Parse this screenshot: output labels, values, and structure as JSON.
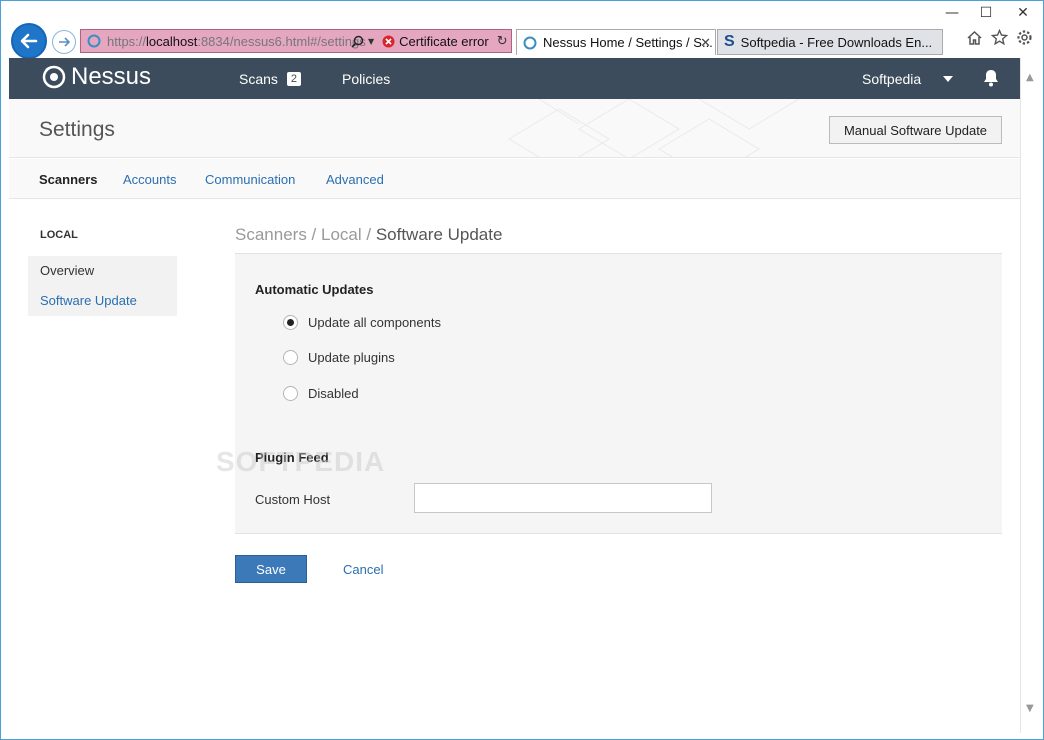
{
  "browser": {
    "url_prefix": "https://",
    "url_host": "localhost",
    "url_rest": ":8834/nessus6.html#/settings",
    "cert_error": "Certificate error",
    "tabs": [
      {
        "title": "Nessus Home / Settings / S...",
        "close": "✕"
      },
      {
        "title": "Softpedia - Free Downloads En..."
      }
    ],
    "window_controls": {
      "minimize": "—",
      "maximize": "☐",
      "close": "✕"
    }
  },
  "header": {
    "logo": "Nessus",
    "scans_label": "Scans",
    "scans_count": "2",
    "policies_label": "Policies",
    "user": "Softpedia"
  },
  "page": {
    "title": "Settings",
    "manual_update": "Manual Software Update",
    "tabs": [
      "Scanners",
      "Accounts",
      "Communication",
      "Advanced"
    ]
  },
  "sidebar": {
    "heading": "LOCAL",
    "items": [
      "Overview",
      "Software Update"
    ]
  },
  "breadcrumb": {
    "part1": "Scanners",
    "sep": " / ",
    "part2": "Local",
    "current": "Software Update"
  },
  "form": {
    "auto_updates_title": "Automatic Updates",
    "options": [
      "Update all components",
      "Update plugins",
      "Disabled"
    ],
    "selected_option": "Update all components",
    "plugin_feed_title": "Plugin Feed",
    "custom_host_label": "Custom Host",
    "custom_host_value": ""
  },
  "actions": {
    "save": "Save",
    "cancel": "Cancel"
  },
  "watermark": "SOFTPEDIA",
  "colors": {
    "header_bg": "#3c4c5c",
    "link": "#2a6fb0",
    "primary_button": "#3b79b8",
    "cert_error_bar": "#e5a6c0"
  }
}
